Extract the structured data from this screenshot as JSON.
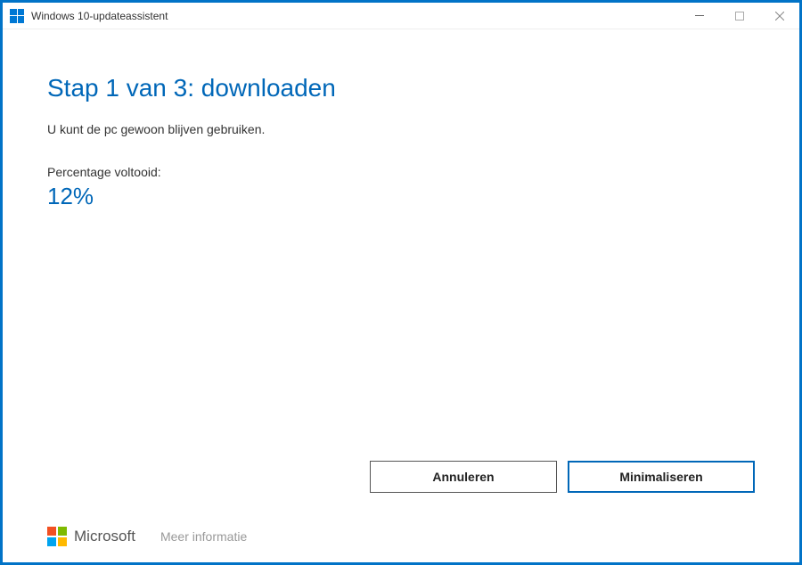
{
  "window": {
    "title": "Windows 10-updateassistent"
  },
  "main": {
    "heading": "Stap 1 van 3: downloaden",
    "subtext": "U kunt de pc gewoon blijven gebruiken.",
    "progress_label": "Percentage voltooid:",
    "progress_value": "12%"
  },
  "buttons": {
    "cancel": "Annuleren",
    "minimize": "Minimaliseren"
  },
  "footer": {
    "brand": "Microsoft",
    "more_info": "Meer informatie"
  }
}
